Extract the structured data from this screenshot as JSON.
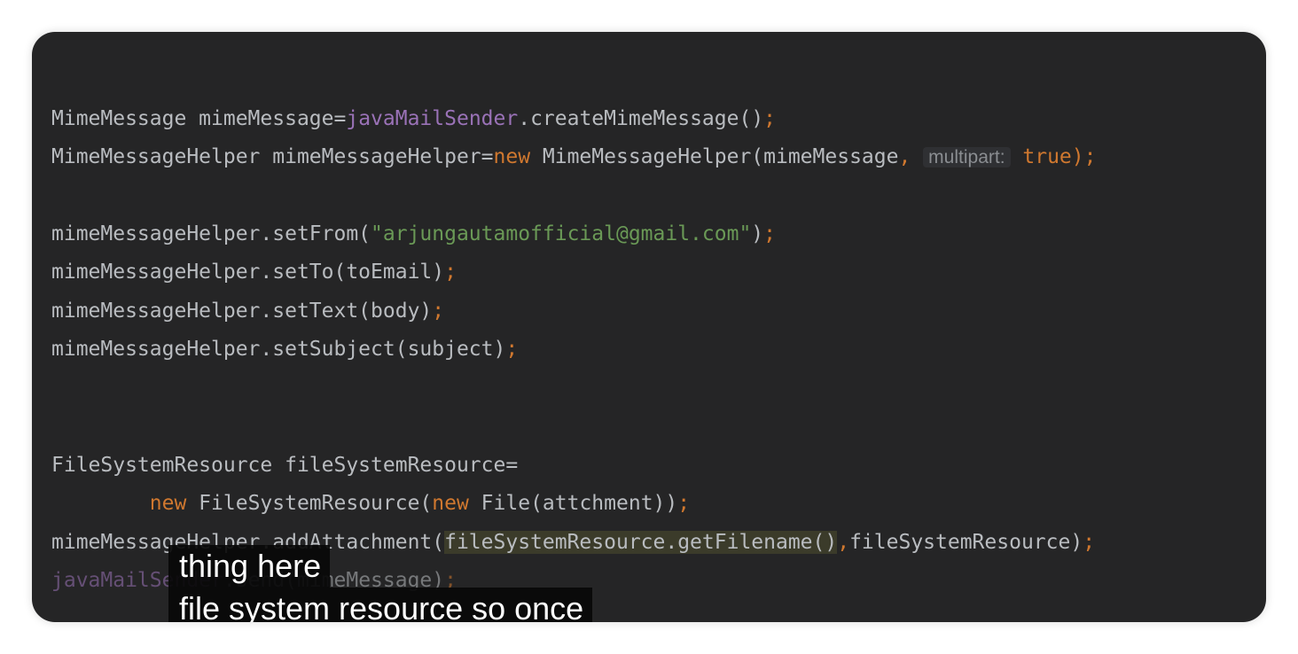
{
  "code": {
    "l1": {
      "t1": "MimeMessage mimeMessage=",
      "t2": "javaMailSender",
      "t3": ".createMimeMessage()",
      "t4": ";"
    },
    "l2": {
      "t1": "MimeMessageHelper mimeMessageHelper=",
      "t2": "new",
      "t3": " MimeMessageHelper(mimeMessage",
      "t4": ", ",
      "hint": "multipart:",
      "t5": " ",
      "t6": "true",
      "t7": ");"
    },
    "l3": {
      "t1": "mimeMessageHelper.setFrom(",
      "t2": "\"arjungautamofficial@gmail.com\"",
      "t3": ")",
      "t4": ";"
    },
    "l4": {
      "t1": "mimeMessageHelper.setTo(toEmail)",
      "t2": ";"
    },
    "l5": {
      "t1": "mimeMessageHelper.setText(body)",
      "t2": ";"
    },
    "l6": {
      "t1": "mimeMessageHelper.setSubject(subject)",
      "t2": ";"
    },
    "l7": {
      "t1": "FileSystemResource fileSystemResource="
    },
    "l8": {
      "t1": "        ",
      "t2": "new",
      "t3": " FileSystemResource(",
      "t4": "new",
      "t5": " File(attchment))",
      "t6": ";"
    },
    "l9": {
      "t1": "mimeMessageHelper.addAttachment(",
      "t2": "fileSystemResource.getFilename()",
      "t3": ",",
      "t4": "fileSystemResource)",
      "t5": ";"
    },
    "l10": {
      "t1": "javaMailSender",
      "t2": ".send(mimeMessage)",
      "t3": ";"
    }
  },
  "captions": [
    "thing here",
    "file system resource so once"
  ]
}
